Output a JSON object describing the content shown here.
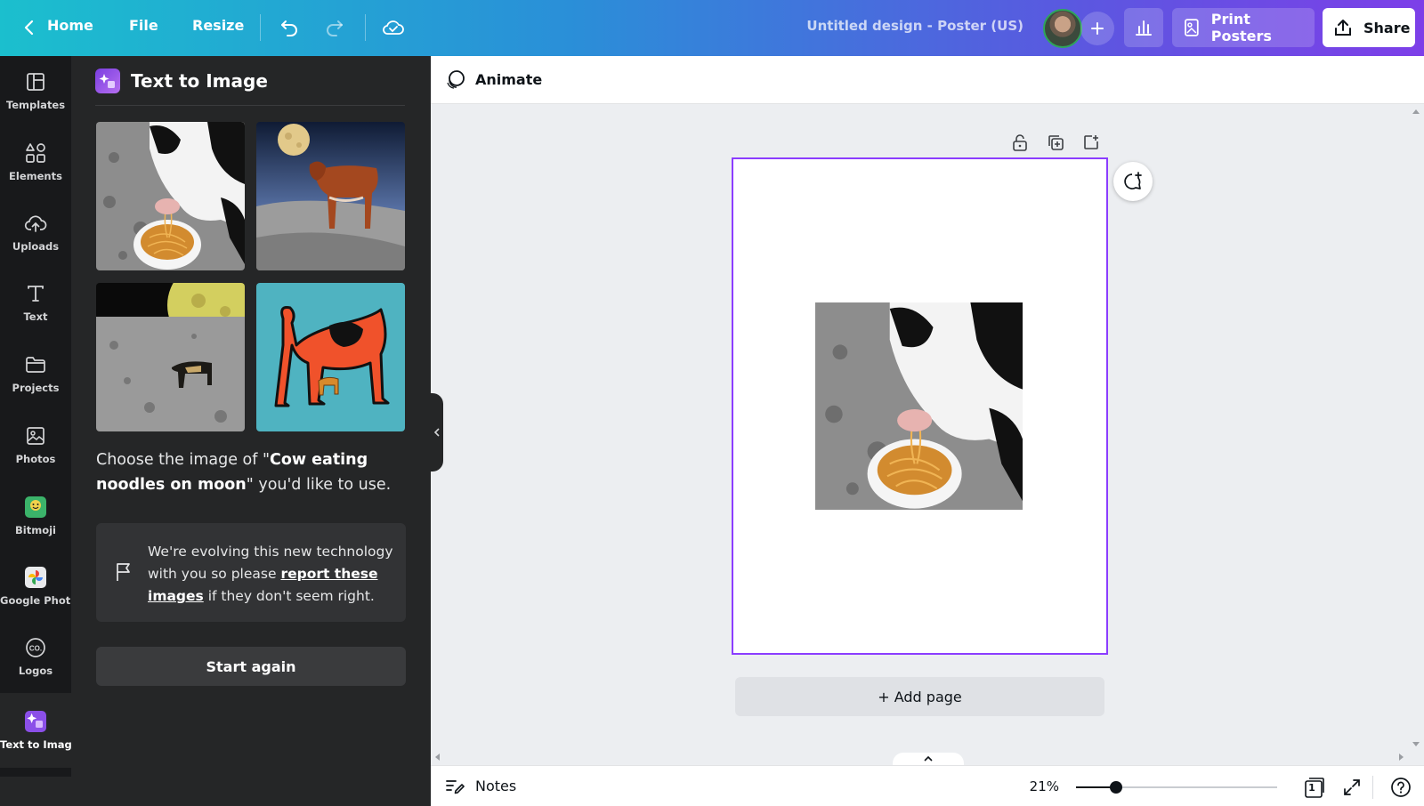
{
  "topbar": {
    "home_label": "Home",
    "file_label": "File",
    "resize_label": "Resize",
    "design_title": "Untitled design - Poster (US)",
    "print_label": "Print Posters",
    "share_label": "Share"
  },
  "rail": {
    "items": [
      {
        "label": "Templates",
        "icon": "templates-icon"
      },
      {
        "label": "Elements",
        "icon": "elements-icon"
      },
      {
        "label": "Uploads",
        "icon": "uploads-icon"
      },
      {
        "label": "Text",
        "icon": "text-icon"
      },
      {
        "label": "Projects",
        "icon": "projects-icon"
      },
      {
        "label": "Photos",
        "icon": "photos-icon"
      },
      {
        "label": "Bitmoji",
        "icon": "bitmoji-icon"
      },
      {
        "label": "Google Phot...",
        "icon": "google-photos-icon"
      },
      {
        "label": "Logos",
        "icon": "logos-icon"
      },
      {
        "label": "Text to Image",
        "icon": "text-to-image-icon"
      }
    ],
    "active": "Text to Image"
  },
  "panel": {
    "title": "Text to Image",
    "choose_prefix": "Choose the image of \"",
    "prompt": "Cow eating noodles on moon",
    "choose_suffix": "\" you'd like to use.",
    "info_prefix": "We're evolving this new technology with you so please ",
    "info_link": "report these images",
    "info_suffix": " if they don't seem right.",
    "start_again_label": "Start again"
  },
  "canvas": {
    "animate_label": "Animate",
    "add_page_label": "+ Add page"
  },
  "footer": {
    "notes_label": "Notes",
    "zoom": "21%",
    "zoom_fraction": 0.2,
    "page_count": "1"
  },
  "colors": {
    "accent": "#8b3dff",
    "panel_bg": "#252627",
    "rail_bg": "#18191b"
  }
}
